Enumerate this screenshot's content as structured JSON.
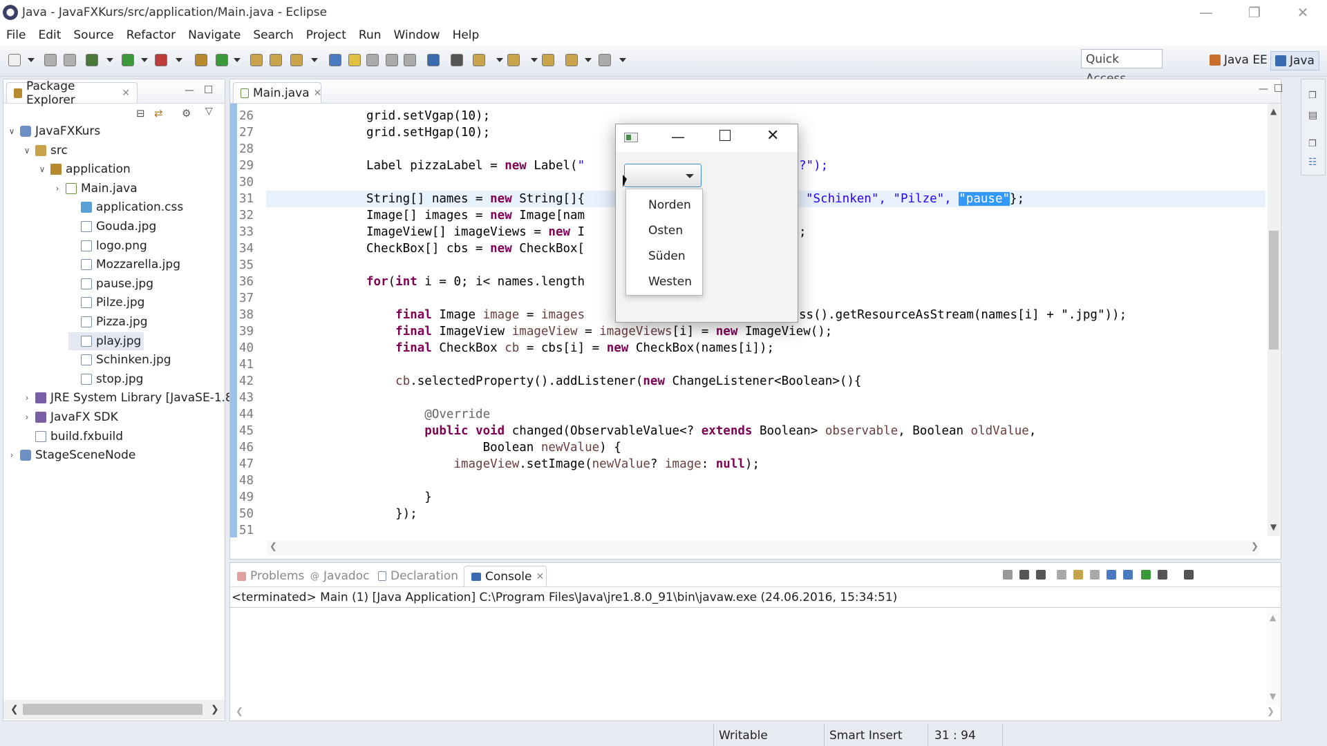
{
  "window": {
    "title": "Java - JavaFXKurs/src/application/Main.java - Eclipse"
  },
  "menu": [
    "File",
    "Edit",
    "Source",
    "Refactor",
    "Navigate",
    "Search",
    "Project",
    "Run",
    "Window",
    "Help"
  ],
  "toolbar": {
    "quick_access": "Quick Access",
    "perspectives": [
      "Java EE",
      "Java"
    ]
  },
  "package_explorer": {
    "tab": "Package Explorer",
    "items": [
      {
        "label": "JavaFXKurs",
        "icon": "project-icon",
        "twisty": "v"
      },
      {
        "label": "src",
        "icon": "source-folder-icon",
        "twisty": "v"
      },
      {
        "label": "application",
        "icon": "package-icon",
        "twisty": "v"
      },
      {
        "label": "Main.java",
        "icon": "java-file-icon",
        "twisty": ">"
      },
      {
        "label": "application.css",
        "icon": "css-file-icon",
        "twisty": ""
      },
      {
        "label": "Gouda.jpg",
        "icon": "file-icon",
        "twisty": ""
      },
      {
        "label": "logo.png",
        "icon": "file-icon",
        "twisty": ""
      },
      {
        "label": "Mozzarella.jpg",
        "icon": "file-icon",
        "twisty": ""
      },
      {
        "label": "pause.jpg",
        "icon": "file-icon",
        "twisty": ""
      },
      {
        "label": "Pilze.jpg",
        "icon": "file-icon",
        "twisty": ""
      },
      {
        "label": "Pizza.jpg",
        "icon": "file-icon",
        "twisty": ""
      },
      {
        "label": "play.jpg",
        "icon": "file-icon",
        "twisty": ""
      },
      {
        "label": "Schinken.jpg",
        "icon": "file-icon",
        "twisty": ""
      },
      {
        "label": "stop.jpg",
        "icon": "file-icon",
        "twisty": ""
      },
      {
        "label": "JRE System Library [JavaSE-1.8",
        "icon": "library-icon",
        "twisty": ">"
      },
      {
        "label": "JavaFX SDK",
        "icon": "library-icon",
        "twisty": ">"
      },
      {
        "label": "build.fxbuild",
        "icon": "file-icon",
        "twisty": ""
      },
      {
        "label": "StageSceneNode",
        "icon": "project-icon",
        "twisty": ">"
      }
    ]
  },
  "editor": {
    "tab": "Main.java",
    "lines": [
      {
        "n": "26",
        "t": "grid.setVgap(10);"
      },
      {
        "n": "27",
        "t": "grid.setHgap(10);"
      },
      {
        "n": "28",
        "t": ""
      },
      {
        "n": "29",
        "t": "Label pizzaLabel = new Label(\""
      },
      {
        "n": "30",
        "t": ""
      },
      {
        "n": "31",
        "t": "String[] names = new String[]{"
      },
      {
        "n": "32",
        "t": "Image[] images = new Image[nam"
      },
      {
        "n": "33",
        "t": "ImageView[] imageViews = new I"
      },
      {
        "n": "34",
        "t": "CheckBox[] cbs = new CheckBox["
      },
      {
        "n": "35",
        "t": ""
      },
      {
        "n": "36",
        "t": "for(int i = 0; i< names.length"
      },
      {
        "n": "37",
        "t": ""
      },
      {
        "n": "38",
        "t": "    final Image image = images"
      },
      {
        "n": "39",
        "t": "    final ImageView imageView = imageViews[i] = new ImageView();"
      },
      {
        "n": "40",
        "t": "    final CheckBox cb = cbs[i] = new CheckBox(names[i]);"
      },
      {
        "n": "41",
        "t": ""
      },
      {
        "n": "42",
        "t": "    cb.selectedProperty().addListener(new ChangeListener<Boolean>(){"
      },
      {
        "n": "43",
        "t": ""
      },
      {
        "n": "44",
        "t": "        @Override"
      },
      {
        "n": "45",
        "t": "        public void changed(ObservableValue<? extends Boolean> observable, Boolean oldValue,"
      },
      {
        "n": "46",
        "t": "                Boolean newValue) {"
      },
      {
        "n": "47",
        "t": "            imageView.setImage(newValue? image: null);"
      },
      {
        "n": "48",
        "t": ""
      },
      {
        "n": "49",
        "t": "        }"
      },
      {
        "n": "50",
        "t": "    });"
      },
      {
        "n": "51",
        "t": ""
      }
    ],
    "overflow": {
      "line29": "?\");",
      "line31_a": "\"Schinken\", \"Pilze\", ",
      "line31_sel": "\"pause\"",
      "line31_b": "};",
      "line33": ";",
      "line38": "ss().getResourceAsStream(names[i] + \".jpg\"));"
    }
  },
  "fx_window": {
    "options": [
      "Norden",
      "Osten",
      "Süden",
      "Westen"
    ]
  },
  "bottom_panel": {
    "tabs": [
      "Problems",
      "Javadoc",
      "Declaration",
      "Console"
    ],
    "console_text": "<terminated> Main (1) [Java Application] C:\\Program Files\\Java\\jre1.8.0_91\\bin\\javaw.exe (24.06.2016, 15:34:51)"
  },
  "status": {
    "writable": "Writable",
    "insert_mode": "Smart Insert",
    "position": "31 : 94"
  }
}
